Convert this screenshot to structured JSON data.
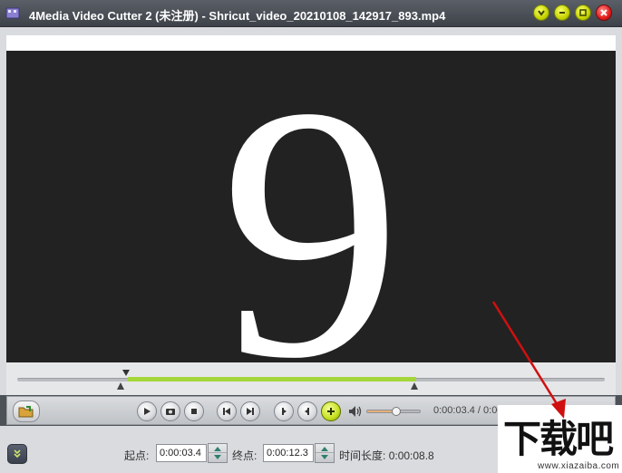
{
  "window": {
    "title": "4Media Video Cutter 2 (未注册) - Shricut_video_20210108_142917_893.mp4",
    "icons": [
      "app-icon",
      "dropdown-icon",
      "minimize-icon",
      "maximize-icon",
      "close-icon"
    ]
  },
  "video": {
    "frame_digit": "9",
    "background": "#222222"
  },
  "timeline": {
    "range_color": "#a4d63a"
  },
  "controls": {
    "time_readout": "0:00:03.4 / 0:00:18.3",
    "volume_level": 0.55,
    "icons": [
      "open-file-icon",
      "play-icon",
      "snapshot-icon",
      "stop-icon",
      "previous-frame-icon",
      "next-frame-icon",
      "set-start-icon",
      "set-end-icon",
      "add-segment-icon",
      "volume-icon"
    ]
  },
  "clip": {
    "start_label": "起点:",
    "start_value": "0:00:03.4",
    "end_label": "终点:",
    "end_value": "0:00:12.3",
    "duration_label": "时间长度:",
    "duration_value": "0:00:08.8"
  },
  "watermark": {
    "text": "下载吧",
    "url": "www.xiazaiba.com"
  }
}
